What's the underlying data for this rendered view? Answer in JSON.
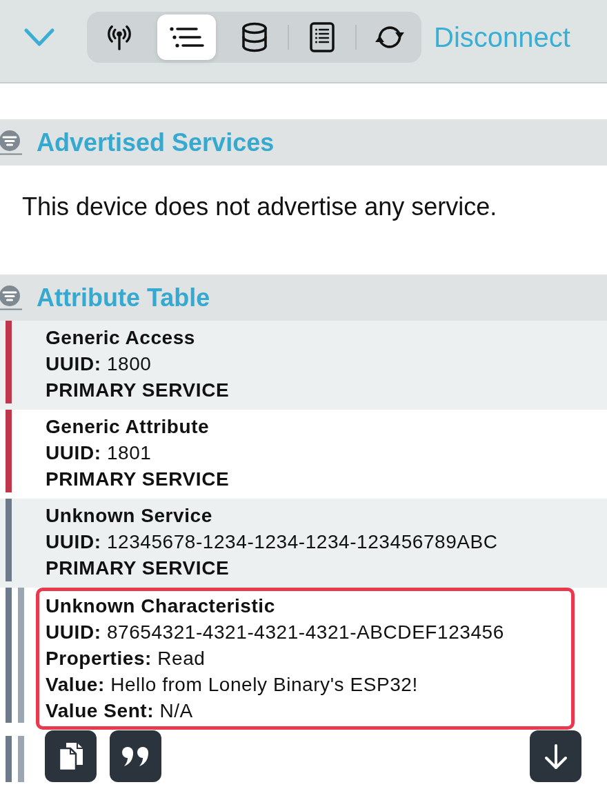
{
  "toolbar": {
    "tabs": [
      {
        "kind": "antenna",
        "selected": false
      },
      {
        "kind": "list",
        "selected": true
      },
      {
        "kind": "database",
        "selected": false
      },
      {
        "kind": "notebook",
        "selected": false
      },
      {
        "kind": "refresh",
        "selected": false
      }
    ],
    "disconnect": "Disconnect"
  },
  "advertised_services": {
    "title": "Advertised Services",
    "message": "This device does not advertise any service."
  },
  "attribute_table": {
    "title": "Attribute Table",
    "services": [
      {
        "name": "Generic Access",
        "uuid": "**UUID:** 1800",
        "type": "PRIMARY SERVICE",
        "color": "#c0364a"
      },
      {
        "name": "Generic Attribute",
        "uuid": "**UUID:** 1801",
        "type": "PRIMARY SERVICE",
        "color": "#c0364a"
      },
      {
        "name": "Unknown Service",
        "uuid": "**UUID:** 12345678-1234-1234-1234-123456789ABC",
        "type": "PRIMARY SERVICE",
        "color": "#6c7a89",
        "children": [
          {
            "name": "Unknown Characteristic",
            "details": [
              "**UUID:** 87654321-4321-4321-4321-ABCDEF123456",
              "**Properties:** Read",
              "**Value:** Hello from Lonely Binary's ESP32!",
              "**Value Sent:** N/A"
            ],
            "color": "#9ba6b1",
            "highlighted": true
          }
        ]
      }
    ]
  }
}
